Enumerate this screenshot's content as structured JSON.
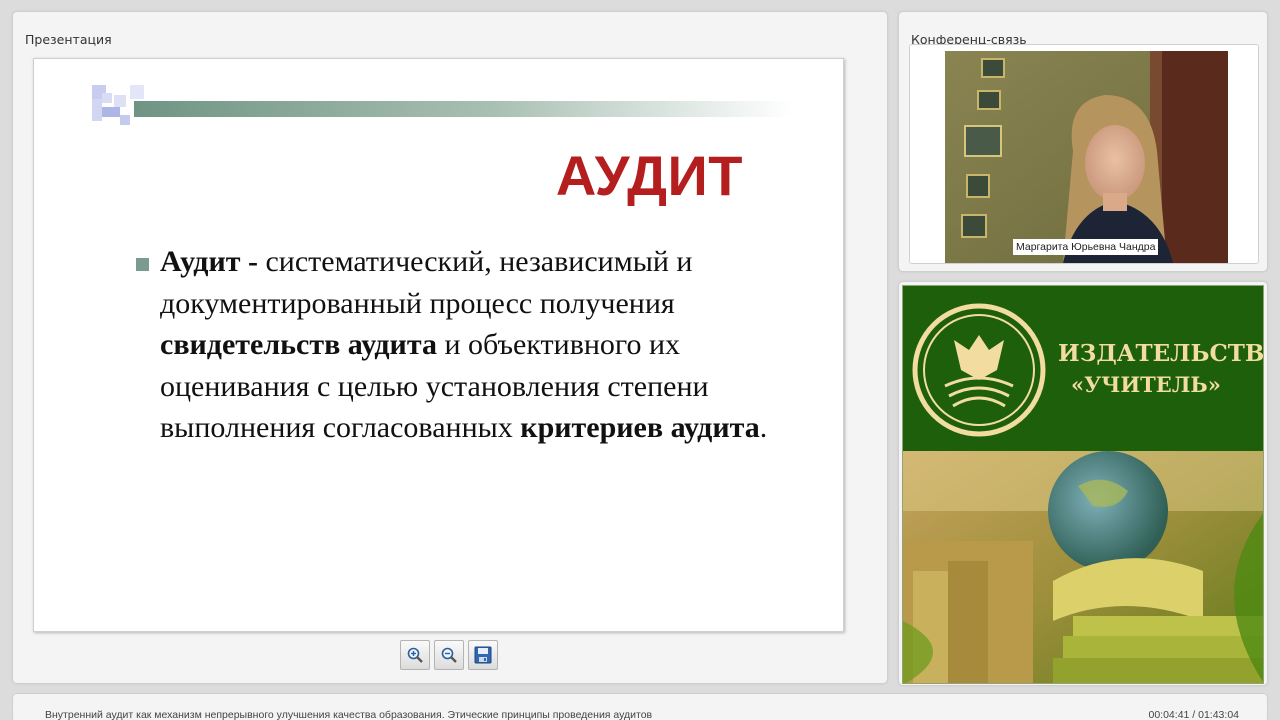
{
  "presentation_panel": {
    "title": "Презентация",
    "slide": {
      "heading": "АУДИТ",
      "body": [
        {
          "text": "Аудит -",
          "bold": true
        },
        {
          "text": " систематический, независимый и документированный процесс получения ",
          "bold": false
        },
        {
          "text": "свидетельств аудита",
          "bold": true
        },
        {
          "text": " и объективного их оценивания с целью установления степени выполнения согласованных ",
          "bold": false
        },
        {
          "text": "критериев аудита",
          "bold": true
        },
        {
          "text": ".",
          "bold": false
        }
      ],
      "heading_color": "#b51e1e",
      "bullet_color": "#7b9b90"
    },
    "toolbar": {
      "zoom_in_icon": "zoom-in-icon",
      "zoom_out_icon": "zoom-out-icon",
      "save_icon": "floppy-disk-icon"
    }
  },
  "conference_panel": {
    "title": "Конференц-связь",
    "participant_name": "Маргарита Юрьевна Чандра"
  },
  "ad_panel": {
    "brand_line1": "ИЗДАТЕЛЬСТВО",
    "brand_line2": "«УЧИТЕЛЬ»",
    "brand_bg": "#1d5f0a",
    "brand_text_color": "#f2dca0"
  },
  "status_bar": {
    "title": "Внутренний аудит как механизм непрерывного улучшения качества образования. Этические принципы проведения аудитов",
    "time": "00:04:41 / 01:43:04"
  }
}
